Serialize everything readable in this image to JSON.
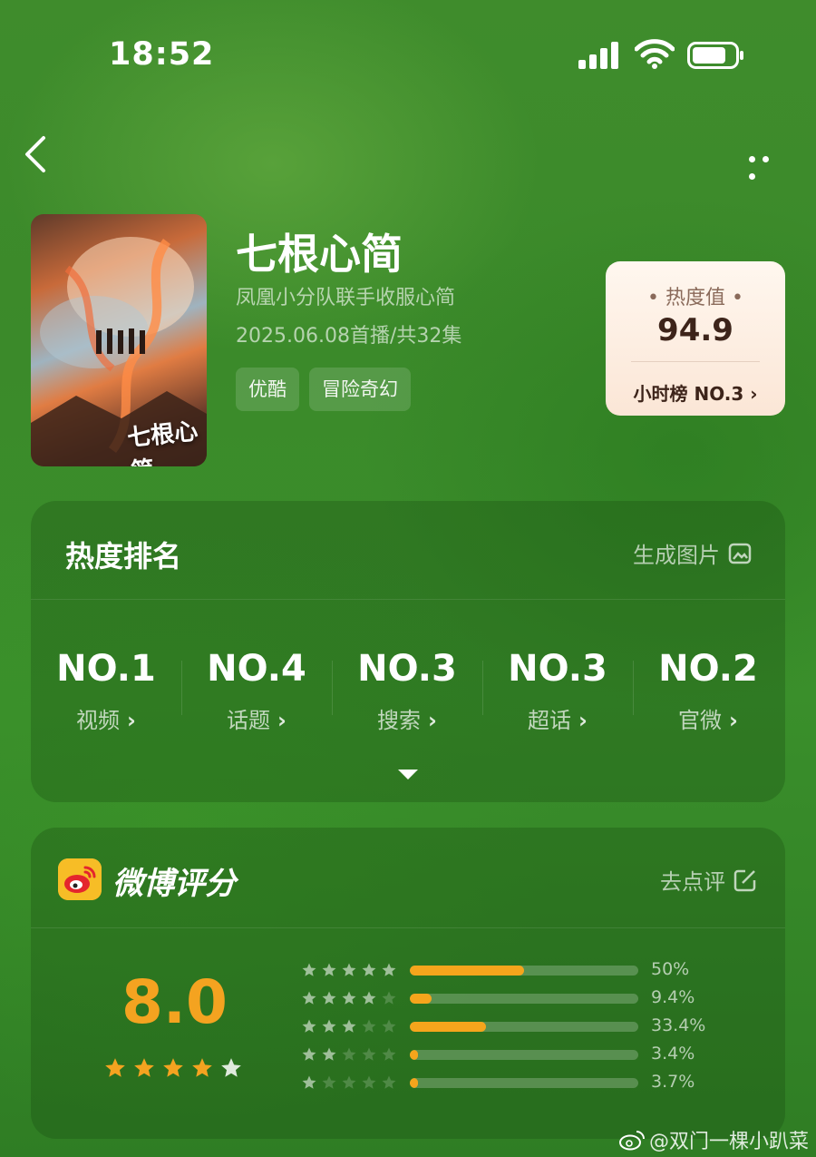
{
  "status_bar": {
    "time": "18:52"
  },
  "show": {
    "title": "七根心简",
    "poster_title": "七根心简",
    "subtitle": "凤凰小分队联手收服心简",
    "premiere": "2025.06.08首播/共32集",
    "tags": [
      "优酷",
      "冒险奇幻"
    ]
  },
  "heat_card": {
    "label": "• 热度值 •",
    "value": "94.9",
    "rank_text": "小时榜 NO.3 ›"
  },
  "ranking": {
    "title": "热度排名",
    "generate_label": "生成图片",
    "items": [
      {
        "rank": "NO.1",
        "name": "视频"
      },
      {
        "rank": "NO.4",
        "name": "话题"
      },
      {
        "rank": "NO.3",
        "name": "搜索"
      },
      {
        "rank": "NO.3",
        "name": "超话"
      },
      {
        "rank": "NO.2",
        "name": "官微"
      }
    ]
  },
  "rating": {
    "title": "微博评分",
    "action_label": "去点评",
    "score": "8.0",
    "score_stars": 4,
    "distribution": [
      {
        "stars": 5,
        "percent_label": "50%",
        "fill": 0.5
      },
      {
        "stars": 4,
        "percent_label": "9.4%",
        "fill": 0.094
      },
      {
        "stars": 3,
        "percent_label": "33.4%",
        "fill": 0.334
      },
      {
        "stars": 2,
        "percent_label": "3.4%",
        "fill": 0.034
      },
      {
        "stars": 1,
        "percent_label": "3.7%",
        "fill": 0.037
      }
    ]
  },
  "watermark": "@双门一棵小趴菜",
  "colors": {
    "accent": "#f4a320",
    "bar_fill": "#f5a51c",
    "heat_card_bg": "#fdeee2"
  }
}
